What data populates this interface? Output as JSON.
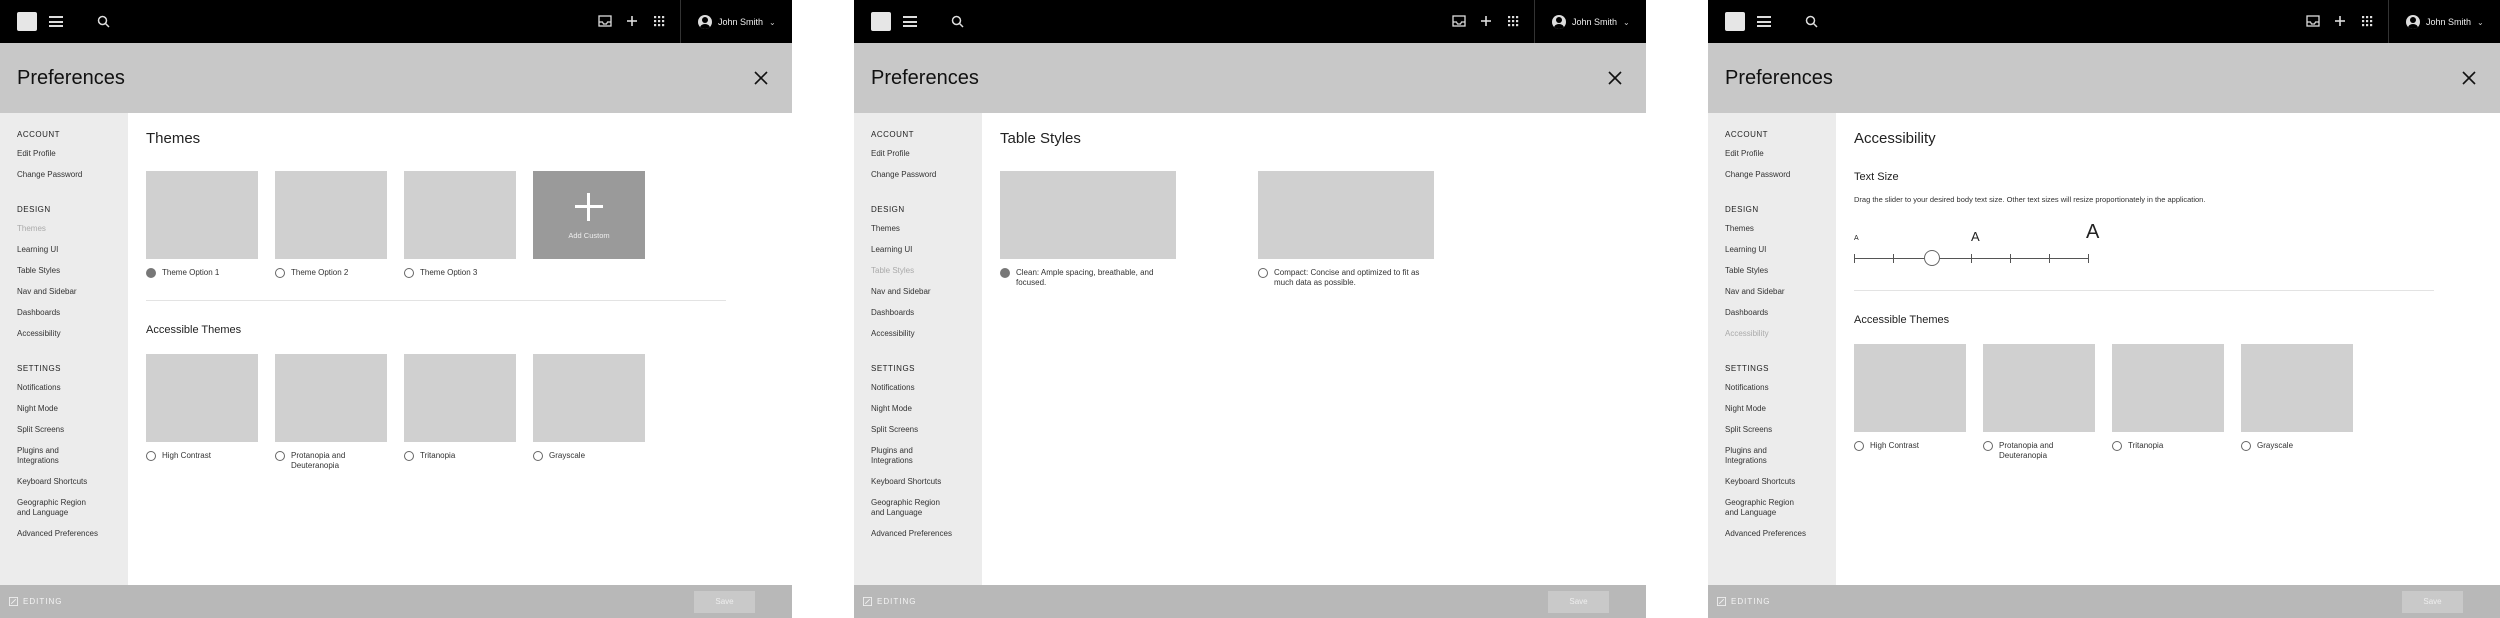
{
  "topbar": {
    "user_name": "John Smith",
    "chevron": "⌄"
  },
  "header": {
    "title": "Preferences"
  },
  "sidebar": {
    "account_heading": "ACCOUNT",
    "account_items": [
      "Edit Profile",
      "Change Password"
    ],
    "design_heading": "DESIGN",
    "design_items": [
      "Themes",
      "Learning UI",
      "Table Styles",
      "Nav and Sidebar",
      "Dashboards",
      "Accessibility"
    ],
    "settings_heading": "SETTINGS",
    "settings_items": [
      "Notifications",
      "Night Mode",
      "Split Screens",
      "Plugins and Integrations",
      "Keyboard Shortcuts",
      "Geographic Region and Language",
      "Advanced Preferences"
    ]
  },
  "footer": {
    "editing": "EDITING",
    "save": "Save"
  },
  "screen1": {
    "title": "Themes",
    "options": [
      "Theme Option 1",
      "Theme Option 2",
      "Theme Option 3"
    ],
    "add_custom": "Add Custom",
    "accessible_title": "Accessible Themes",
    "accessible_options": [
      "High Contrast",
      "Protanopia and Deuteranopia",
      "Tritanopia",
      "Grayscale"
    ]
  },
  "screen2": {
    "title": "Table Styles",
    "options": [
      "Clean: Ample spacing, breathable, and focused.",
      "Compact: Concise and optimized to fit as much data as possible."
    ]
  },
  "screen3": {
    "title": "Accessibility",
    "text_size_title": "Text Size",
    "text_size_desc": "Drag the slider to your desired body text size. Other text sizes will resize proportionately in the application.",
    "size_labels": [
      "A",
      "A",
      "A"
    ],
    "slider_position_fraction": 0.33,
    "accessible_title": "Accessible Themes",
    "accessible_options": [
      "High Contrast",
      "Protanopia and Deuteranopia",
      "Tritanopia",
      "Grayscale"
    ]
  },
  "icons": [
    "logo-icon",
    "hamburger-icon",
    "search-icon",
    "inbox-icon",
    "plus-icon",
    "apps-grid-icon",
    "user-avatar-icon",
    "close-icon",
    "pencil-icon"
  ]
}
